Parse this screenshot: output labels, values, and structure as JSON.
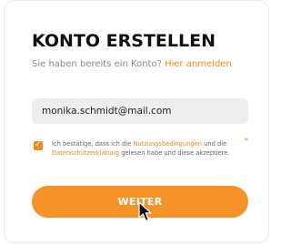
{
  "form": {
    "title": "KONTO ERSTELLEN",
    "subtitle_text": "Sie haben bereits ein Konto?",
    "login_link": "Hier anmelden",
    "email_value": "monika.schmidt@mail.com",
    "consent": {
      "checked": true,
      "part1": "Ich bestätige, dass ich die",
      "terms_link": "Nutzungsbedingungen",
      "part2": "und die",
      "privacy_link": "Datenschutzerklärung",
      "part3": "gelesen habe und diese akzeptiere.",
      "required_marker": "*"
    },
    "submit_label": "WEITER"
  },
  "colors": {
    "accent": "#f5932a",
    "link": "#f08a1c",
    "field_background": "#eeeeee"
  },
  "icons": {
    "checkbox": "check-icon",
    "cursor": "mouse-pointer-icon"
  }
}
